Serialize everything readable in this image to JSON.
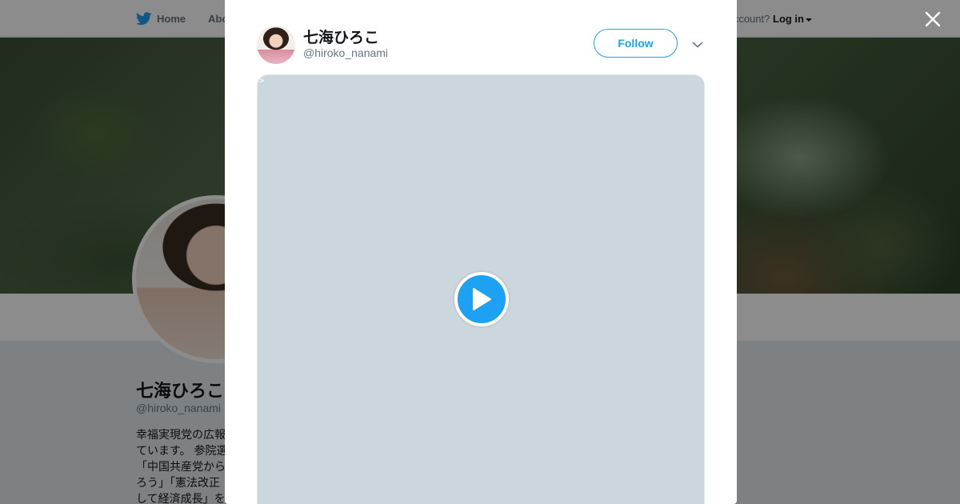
{
  "topbar": {
    "home_label": "Home",
    "about_label": "Abo",
    "account_prompt": "ccount?",
    "login_label": "Log in"
  },
  "profile": {
    "name": "七海ひろこ",
    "handle": "@hiroko_nanami",
    "bio": "幸福実現党の広報\nています。 参院選\n「中国共産党から\nろう」「憲法改正\nして経済成長」を"
  },
  "modal": {
    "name": "七海ひろこ",
    "handle": "@hiroko_nanami",
    "follow_label": "Follow",
    "media_stray_text": ">"
  },
  "colors": {
    "accent": "#1da1f2",
    "media_placeholder": "#ccd6dd"
  },
  "icons": {
    "close": "close-icon",
    "chevron": "chevron-down-icon",
    "play": "play-icon",
    "bird": "twitter-bird-icon"
  }
}
